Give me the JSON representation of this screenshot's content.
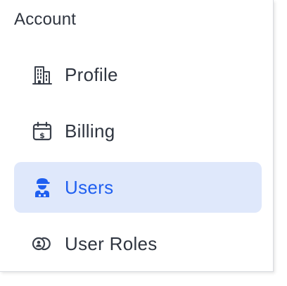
{
  "section": {
    "title": "Account"
  },
  "menu": {
    "items": [
      {
        "label": "Profile",
        "icon": "building-icon",
        "active": false
      },
      {
        "label": "Billing",
        "icon": "calendar-dollar-icon",
        "active": false
      },
      {
        "label": "Users",
        "icon": "user-cap-icon",
        "active": true
      },
      {
        "label": "User Roles",
        "icon": "user-toggle-icon",
        "active": false
      }
    ]
  },
  "colors": {
    "accent": "#1f5ff0",
    "active_bg": "#dfe8fb",
    "text": "#2f3540"
  }
}
